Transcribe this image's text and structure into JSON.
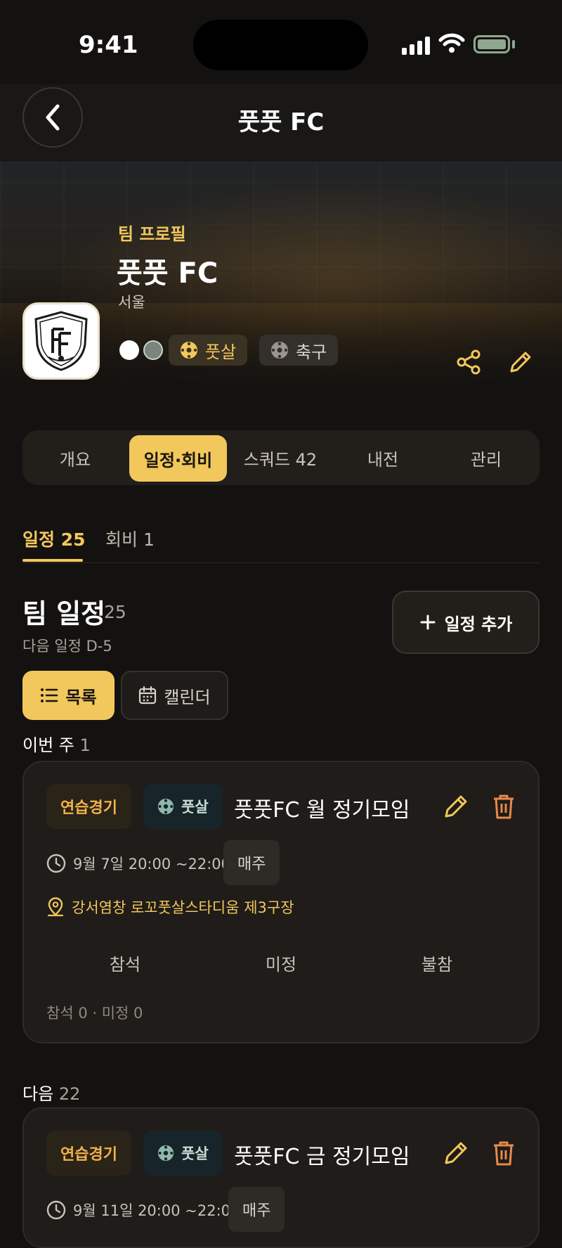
{
  "status_bar": {
    "time": "9:41"
  },
  "header": {
    "title": "풋풋 FC"
  },
  "hero": {
    "eyebrow": "팀 프로필",
    "team_name": "풋풋 FC",
    "city": "서울",
    "uniform_colors": [
      "#ffffff",
      "#7a857e"
    ],
    "sports": [
      {
        "label": "풋살",
        "active": true
      },
      {
        "label": "축구",
        "active": false
      }
    ]
  },
  "tabs": [
    {
      "label": "개요",
      "active": false
    },
    {
      "label": "일정·회비",
      "active": true
    },
    {
      "label": "스쿼드 42",
      "active": false
    },
    {
      "label": "내전",
      "active": false
    },
    {
      "label": "관리",
      "active": false
    }
  ],
  "subtabs": [
    {
      "label": "일정",
      "count": "25",
      "active": true
    },
    {
      "label": "회비",
      "count": "1",
      "active": false
    }
  ],
  "schedule": {
    "title": "팀 일정",
    "count": "25",
    "next_label": "다음 일정 D-5",
    "add_button": "일정 추가",
    "view_list": "목록",
    "view_calendar": "캘린더"
  },
  "groups": [
    {
      "label": "이번 주",
      "count": "1",
      "events": [
        {
          "type": "연습경기",
          "sport": "풋살",
          "title": "풋풋FC 월 정기모임",
          "time": "9월 7일 20:00 ~22:00",
          "repeat": "매주",
          "location": "강서염창 로꼬풋살스타디움 제3구장",
          "attendance": [
            "참석",
            "미정",
            "불참"
          ],
          "summary": "참석 0 · 미정 0"
        }
      ]
    },
    {
      "label": "다음",
      "count": "22",
      "events": [
        {
          "type": "연습경기",
          "sport": "풋살",
          "title": "풋풋FC 금 정기모임",
          "time": "9월 11일 20:00 ~22:00",
          "repeat": "매주"
        }
      ]
    }
  ],
  "colors": {
    "accent": "#f2c75c",
    "background": "#141210",
    "card": "#1f1c19"
  },
  "icons": [
    "back-chevron-icon",
    "share-icon",
    "pencil-icon",
    "trash-icon",
    "clock-icon",
    "map-pin-icon",
    "plus-icon",
    "list-icon",
    "calendar-icon",
    "futsal-ball-icon",
    "soccer-ball-icon"
  ]
}
